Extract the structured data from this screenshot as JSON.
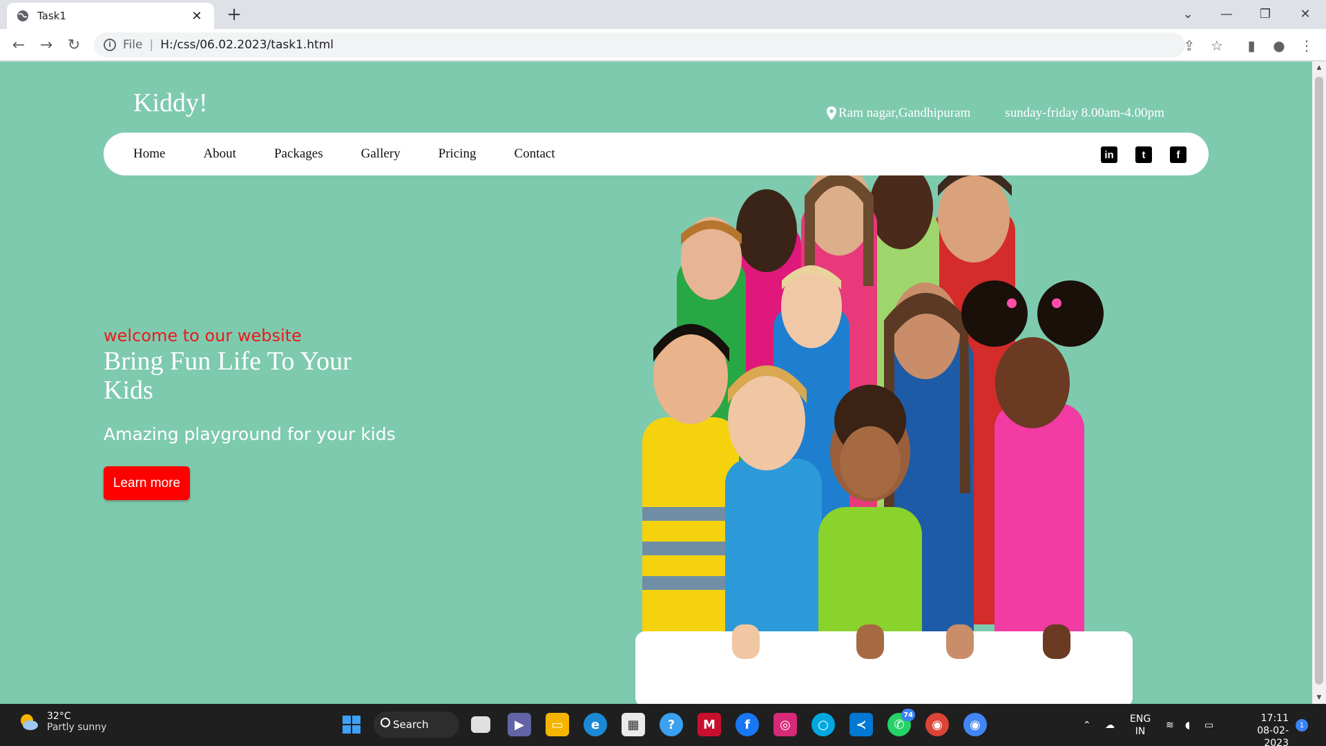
{
  "browser": {
    "tab_title": "Task1",
    "scheme_label": "File",
    "url": "H:/css/06.02.2023/task1.html"
  },
  "site": {
    "brand": "Kiddy!",
    "location": "Ram nagar,Gandhipuram",
    "hours": "sunday-friday 8.00am-4.00pm",
    "nav": [
      "Home",
      "About",
      "Packages",
      "Gallery",
      "Pricing",
      "Contact"
    ],
    "socials": [
      "linkedin-icon",
      "twitter-icon",
      "facebook-icon"
    ],
    "hero": {
      "eyebrow": "welcome to our website",
      "title": "Bring Fun Life To Your Kids",
      "subtitle": "Amazing playground for your kids",
      "cta": "Learn more"
    },
    "colors": {
      "background": "#7ecaae",
      "eyebrow": "#e81b1b",
      "cta": "#ff0000"
    }
  },
  "taskbar": {
    "weather_temp": "32°C",
    "weather_desc": "Partly sunny",
    "search_label": "Search",
    "teams_badge": "74",
    "lang_line1": "ENG",
    "lang_line2": "IN",
    "time": "17:11",
    "date": "08-02-2023",
    "notifications": "1"
  }
}
